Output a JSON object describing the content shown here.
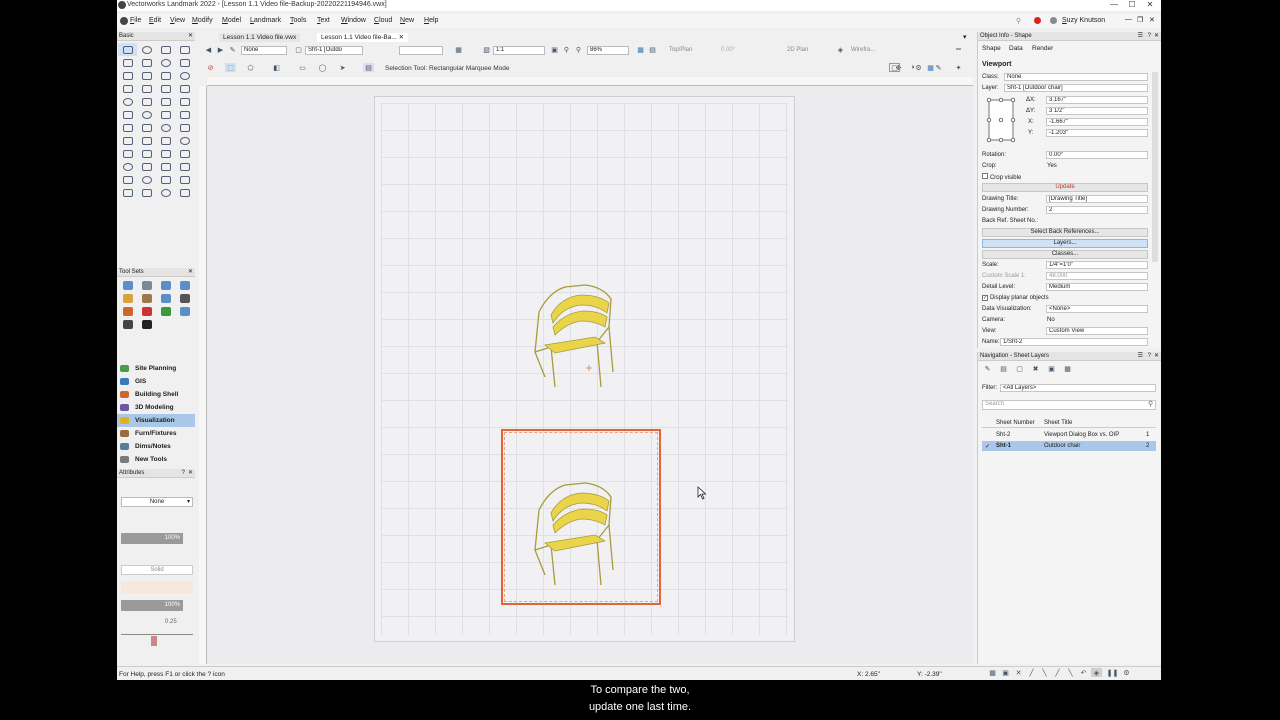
{
  "window": {
    "title": "Vectorworks Landmark 2022 - [Lesson 1.1 Video file-Backup-20220221194946.vwx]",
    "user": "Suzy Knutson",
    "minimize": "—",
    "maximize": "☐",
    "close": "✕"
  },
  "menu": [
    "File",
    "Edit",
    "View",
    "Modify",
    "Model",
    "Landmark",
    "Tools",
    "Text",
    "Window",
    "Cloud",
    "New",
    "Help"
  ],
  "tabs": {
    "tab1": "Lesson 1.1 Video file.vwx",
    "tab2": "Lesson 1.1 Video file-Ba...",
    "tab2_close": "✕"
  },
  "viewbar": {
    "class_select": "None",
    "layer_select": "Sht-1 [Outdo",
    "scale_field": "1:1",
    "zoom": "86%",
    "view": "Top/Plan",
    "rotation": "0.00°",
    "render": "2D Plan",
    "wire": "Wirefra..."
  },
  "toolbar": {
    "mode_text": "Selection Tool: Rectangular Marquee Mode"
  },
  "left": {
    "basic_title": "Basic",
    "toolsets_title": "Tool Sets",
    "workspace": [
      {
        "label": "Site Planning",
        "color": "#4d9a4a"
      },
      {
        "label": "GIS",
        "color": "#3a7ab8"
      },
      {
        "label": "Building Shell",
        "color": "#c86a2d"
      },
      {
        "label": "3D Modeling",
        "color": "#6b59a8"
      },
      {
        "label": "Visualization",
        "color": "#e0b020"
      },
      {
        "label": "Furn/Fixtures",
        "color": "#9a6b3c"
      },
      {
        "label": "Dims/Notes",
        "color": "#5a7d9a"
      },
      {
        "label": "New Tools",
        "color": "#7b7b7b"
      }
    ],
    "attributes_title": "Attributes",
    "fill_value": "None",
    "fill_opacity": "100%",
    "pen_style": "Solid",
    "pen_opacity": "100%",
    "line_weight": "0.25"
  },
  "oip": {
    "header": "Object Info - Shape",
    "tabs": [
      "Shape",
      "Data",
      "Render"
    ],
    "object_type": "Viewport",
    "class_label": "Class:",
    "class_value": "None",
    "layer_label": "Layer:",
    "layer_value": "Sht-1 [Outdoor chair]",
    "dx_label": "ΔX:",
    "dx": "3.167\"",
    "dy_label": "ΔY:",
    "dy": "3 1/2\"",
    "x_label": "X:",
    "x": "-1.667\"",
    "y_label": "Y:",
    "y": "-1.203\"",
    "rotation_label": "Rotation:",
    "rotation": "0.00°",
    "crop_label": "Crop:",
    "crop": "Yes",
    "crop_visible": "Crop visible",
    "update": "Update",
    "drawing_title_label": "Drawing Title:",
    "drawing_title": "[Drawing Title]",
    "drawing_number_label": "Drawing Number:",
    "drawing_number": "2",
    "back_ref_label": "Back Ref. Sheet No.:",
    "select_back_refs": "Select Back References...",
    "layers": "Layers...",
    "classes": "Classes...",
    "scale_label": "Scale:",
    "scale": "1/4\"=1'0\"",
    "custom_scale_label": "Custom Scale 1:",
    "custom_scale": "48.000",
    "detail_label": "Detail Level:",
    "detail": "Medium",
    "display_planar": "Display planar objects",
    "data_vis_label": "Data Visualization:",
    "data_vis": "<None>",
    "camera_label": "Camera:",
    "camera": "No",
    "view_label": "View:",
    "view": "Custom View",
    "name_label": "Name:",
    "name": "1/Sht-2"
  },
  "nav": {
    "header": "Navigation - Sheet Layers",
    "filter_label": "Filter:",
    "filter_value": "<All Layers>",
    "search_placeholder": "Search",
    "col_number": "Sheet Number",
    "col_title": "Sheet Title",
    "rows": [
      {
        "number": "Sht-2",
        "title": "Viewport Dialog Box vs. OIP",
        "order": "1"
      },
      {
        "number": "Sht-1",
        "title": "Outdoor chair",
        "order": "2"
      }
    ]
  },
  "status": {
    "help": "For Help, press F1 or click the ? icon",
    "x": "X: 2.65\"",
    "y": "Y: -2.39\""
  },
  "caption": {
    "line1": "To compare the two,",
    "line2": "update one last time."
  },
  "colors": {
    "accent": "#a9c7e8",
    "crop_border": "#e0663a",
    "chair": "#e8d44a"
  }
}
